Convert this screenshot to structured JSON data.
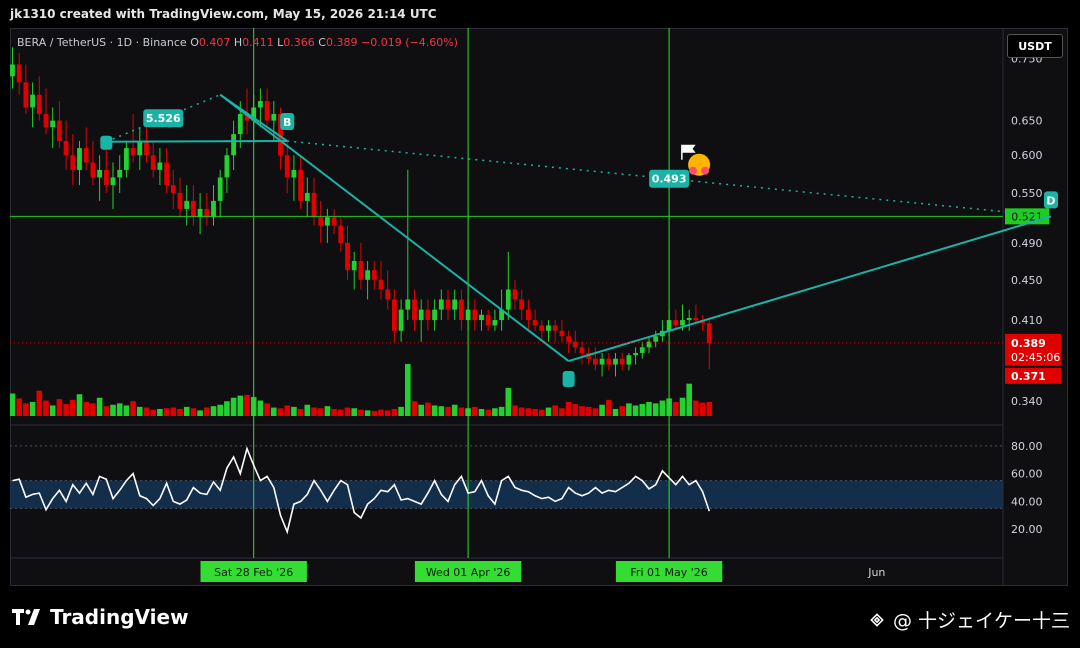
{
  "header": {
    "caption": "jk1310 created with TradingView.com, May 15, 2026 21:14 UTC"
  },
  "symbol": {
    "pair": "BERA / TetherUS · 1D · Binance",
    "o_label": "O",
    "o": "0.407",
    "h_label": "H",
    "h": "0.411",
    "l_label": "L",
    "l": "0.366",
    "c_label": "C",
    "c": "0.389",
    "change": "−0.019 (−4.60%)"
  },
  "currency_button": "USDT",
  "colors": {
    "up": "#22d030",
    "down": "#e00000",
    "pattern_line": "#1ab3a6",
    "vertical_marker": "#33dd33",
    "level_line": "#1fcc1f",
    "rsi_line": "#ffffff",
    "rsi_band": "#13365a"
  },
  "chart_data": [
    {
      "type": "candlestick",
      "scale": "log",
      "x_start": "2026-01-23",
      "ylim": [
        0.327,
        0.805
      ],
      "price_ticks": [
        "0.750",
        "0.650",
        "0.600",
        "0.550",
        "0.490",
        "0.450",
        "0.410",
        "0.340"
      ],
      "date_ticks": [
        {
          "date": "2026-02-28",
          "label": "Sat 28 Feb '26",
          "highlight": true
        },
        {
          "date": "2026-04-01",
          "label": "Wed 01 Apr '26",
          "highlight": true
        },
        {
          "date": "2026-05-01",
          "label": "Fri 01 May '26",
          "highlight": true
        },
        {
          "date": "2026-06-01",
          "label": "Jun",
          "highlight": false
        }
      ],
      "ohlc": [
        [
          0.72,
          0.77,
          0.7,
          0.74
        ],
        [
          0.74,
          0.76,
          0.69,
          0.71
        ],
        [
          0.71,
          0.74,
          0.66,
          0.67
        ],
        [
          0.67,
          0.71,
          0.64,
          0.69
        ],
        [
          0.69,
          0.72,
          0.65,
          0.66
        ],
        [
          0.66,
          0.7,
          0.63,
          0.64
        ],
        [
          0.64,
          0.67,
          0.61,
          0.65
        ],
        [
          0.65,
          0.68,
          0.61,
          0.62
        ],
        [
          0.62,
          0.65,
          0.58,
          0.6
        ],
        [
          0.6,
          0.63,
          0.56,
          0.58
        ],
        [
          0.58,
          0.62,
          0.56,
          0.61
        ],
        [
          0.61,
          0.64,
          0.58,
          0.59
        ],
        [
          0.59,
          0.62,
          0.56,
          0.57
        ],
        [
          0.57,
          0.6,
          0.54,
          0.58
        ],
        [
          0.58,
          0.61,
          0.55,
          0.56
        ],
        [
          0.56,
          0.59,
          0.53,
          0.57
        ],
        [
          0.57,
          0.6,
          0.55,
          0.58
        ],
        [
          0.58,
          0.62,
          0.57,
          0.61
        ],
        [
          0.61,
          0.66,
          0.59,
          0.6
        ],
        [
          0.6,
          0.64,
          0.58,
          0.62
        ],
        [
          0.62,
          0.64,
          0.59,
          0.6
        ],
        [
          0.6,
          0.62,
          0.57,
          0.58
        ],
        [
          0.58,
          0.61,
          0.56,
          0.59
        ],
        [
          0.59,
          0.61,
          0.55,
          0.56
        ],
        [
          0.56,
          0.58,
          0.53,
          0.55
        ],
        [
          0.55,
          0.57,
          0.52,
          0.53
        ],
        [
          0.53,
          0.56,
          0.51,
          0.54
        ],
        [
          0.54,
          0.56,
          0.51,
          0.52
        ],
        [
          0.52,
          0.55,
          0.5,
          0.53
        ],
        [
          0.53,
          0.55,
          0.51,
          0.52
        ],
        [
          0.52,
          0.56,
          0.51,
          0.54
        ],
        [
          0.54,
          0.58,
          0.52,
          0.57
        ],
        [
          0.57,
          0.61,
          0.55,
          0.6
        ],
        [
          0.6,
          0.65,
          0.58,
          0.63
        ],
        [
          0.63,
          0.68,
          0.61,
          0.66
        ],
        [
          0.66,
          0.7,
          0.63,
          0.65
        ],
        [
          0.65,
          0.69,
          0.62,
          0.67
        ],
        [
          0.67,
          0.7,
          0.64,
          0.68
        ],
        [
          0.68,
          0.7,
          0.64,
          0.65
        ],
        [
          0.65,
          0.68,
          0.62,
          0.66
        ],
        [
          0.66,
          0.67,
          0.58,
          0.6
        ],
        [
          0.6,
          0.62,
          0.55,
          0.57
        ],
        [
          0.57,
          0.6,
          0.54,
          0.58
        ],
        [
          0.58,
          0.6,
          0.53,
          0.54
        ],
        [
          0.54,
          0.57,
          0.52,
          0.55
        ],
        [
          0.55,
          0.57,
          0.51,
          0.52
        ],
        [
          0.52,
          0.54,
          0.49,
          0.51
        ],
        [
          0.51,
          0.53,
          0.49,
          0.52
        ],
        [
          0.52,
          0.53,
          0.5,
          0.51
        ],
        [
          0.51,
          0.52,
          0.48,
          0.49
        ],
        [
          0.49,
          0.51,
          0.45,
          0.46
        ],
        [
          0.46,
          0.48,
          0.44,
          0.47
        ],
        [
          0.47,
          0.49,
          0.44,
          0.45
        ],
        [
          0.45,
          0.47,
          0.43,
          0.46
        ],
        [
          0.46,
          0.47,
          0.44,
          0.45
        ],
        [
          0.45,
          0.47,
          0.43,
          0.44
        ],
        [
          0.44,
          0.46,
          0.42,
          0.43
        ],
        [
          0.43,
          0.44,
          0.39,
          0.4
        ],
        [
          0.4,
          0.43,
          0.39,
          0.42
        ],
        [
          0.42,
          0.58,
          0.41,
          0.43
        ],
        [
          0.43,
          0.44,
          0.4,
          0.41
        ],
        [
          0.41,
          0.43,
          0.39,
          0.42
        ],
        [
          0.42,
          0.43,
          0.4,
          0.41
        ],
        [
          0.41,
          0.43,
          0.4,
          0.42
        ],
        [
          0.42,
          0.44,
          0.41,
          0.43
        ],
        [
          0.43,
          0.44,
          0.41,
          0.42
        ],
        [
          0.42,
          0.44,
          0.41,
          0.43
        ],
        [
          0.43,
          0.44,
          0.4,
          0.41
        ],
        [
          0.41,
          0.43,
          0.4,
          0.42
        ],
        [
          0.42,
          0.43,
          0.4,
          0.41
        ],
        [
          0.41,
          0.42,
          0.4,
          0.415
        ],
        [
          0.415,
          0.42,
          0.4,
          0.405
        ],
        [
          0.405,
          0.42,
          0.4,
          0.41
        ],
        [
          0.41,
          0.44,
          0.4,
          0.42
        ],
        [
          0.42,
          0.48,
          0.41,
          0.44
        ],
        [
          0.44,
          0.45,
          0.42,
          0.43
        ],
        [
          0.43,
          0.44,
          0.41,
          0.42
        ],
        [
          0.42,
          0.43,
          0.4,
          0.41
        ],
        [
          0.41,
          0.42,
          0.4,
          0.405
        ],
        [
          0.405,
          0.41,
          0.39,
          0.4
        ],
        [
          0.4,
          0.41,
          0.39,
          0.405
        ],
        [
          0.405,
          0.41,
          0.39,
          0.4
        ],
        [
          0.4,
          0.41,
          0.39,
          0.395
        ],
        [
          0.395,
          0.4,
          0.38,
          0.39
        ],
        [
          0.39,
          0.4,
          0.38,
          0.385
        ],
        [
          0.385,
          0.39,
          0.37,
          0.38
        ],
        [
          0.38,
          0.385,
          0.37,
          0.375
        ],
        [
          0.375,
          0.385,
          0.365,
          0.37
        ],
        [
          0.37,
          0.38,
          0.36,
          0.375
        ],
        [
          0.375,
          0.38,
          0.365,
          0.37
        ],
        [
          0.37,
          0.38,
          0.36,
          0.375
        ],
        [
          0.375,
          0.38,
          0.365,
          0.37
        ],
        [
          0.37,
          0.38,
          0.365,
          0.378
        ],
        [
          0.378,
          0.385,
          0.37,
          0.38
        ],
        [
          0.38,
          0.39,
          0.375,
          0.385
        ],
        [
          0.385,
          0.395,
          0.38,
          0.39
        ],
        [
          0.39,
          0.4,
          0.385,
          0.395
        ],
        [
          0.395,
          0.41,
          0.39,
          0.4
        ],
        [
          0.4,
          0.42,
          0.395,
          0.41
        ],
        [
          0.41,
          0.42,
          0.4,
          0.405
        ],
        [
          0.405,
          0.425,
          0.4,
          0.41
        ],
        [
          0.41,
          0.42,
          0.4,
          0.412
        ],
        [
          0.412,
          0.425,
          0.405,
          0.41
        ],
        [
          0.41,
          0.415,
          0.4,
          0.407
        ],
        [
          0.407,
          0.411,
          0.366,
          0.389
        ]
      ],
      "volume": [
        3.2,
        2.5,
        1.8,
        2.0,
        3.6,
        2.2,
        1.5,
        2.4,
        1.7,
        2.3,
        3.1,
        2.0,
        1.8,
        2.6,
        1.4,
        1.6,
        1.8,
        1.5,
        2.1,
        1.3,
        1.2,
        0.9,
        1.0,
        1.1,
        1.2,
        1.0,
        1.3,
        1.1,
        0.8,
        1.2,
        1.4,
        1.6,
        2.1,
        2.6,
        2.9,
        3.0,
        2.7,
        2.2,
        1.8,
        1.2,
        1.1,
        1.5,
        1.3,
        1.0,
        1.6,
        1.2,
        1.1,
        1.4,
        1.0,
        0.9,
        1.2,
        1.1,
        0.9,
        0.8,
        0.7,
        0.9,
        0.8,
        1.0,
        1.3,
        7.4,
        2.1,
        1.6,
        1.9,
        1.5,
        1.4,
        1.3,
        1.6,
        1.2,
        1.1,
        1.3,
        1.0,
        0.9,
        1.1,
        1.3,
        4.0,
        1.5,
        1.2,
        1.1,
        1.0,
        0.9,
        1.2,
        1.5,
        1.1,
        2.0,
        1.7,
        1.4,
        1.3,
        1.1,
        1.6,
        2.3,
        1.0,
        1.4,
        1.8,
        1.5,
        1.7,
        2.0,
        1.8,
        2.2,
        2.5,
        2.0,
        2.6,
        4.6,
        2.2,
        1.9,
        2.0
      ],
      "rsi": {
        "ticks": [
          "80.00",
          "60.00",
          "40.00",
          "20.00"
        ],
        "band": [
          35,
          55
        ],
        "values": [
          55,
          56,
          43,
          45,
          46,
          34,
          42,
          48,
          40,
          52,
          46,
          53,
          45,
          58,
          56,
          42,
          48,
          55,
          60,
          44,
          42,
          37,
          42,
          53,
          40,
          38,
          41,
          50,
          46,
          45,
          54,
          48,
          64,
          72,
          60,
          78,
          66,
          55,
          58,
          50,
          30,
          18,
          38,
          40,
          45,
          55,
          48,
          40,
          48,
          55,
          52,
          32,
          28,
          38,
          42,
          48,
          47,
          52,
          41,
          42,
          40,
          38,
          46,
          55,
          45,
          40,
          52,
          58,
          46,
          47,
          55,
          44,
          38,
          55,
          58,
          50,
          48,
          47,
          44,
          42,
          43,
          40,
          42,
          50,
          46,
          44,
          46,
          50,
          46,
          48,
          47,
          50,
          53,
          58,
          55,
          49,
          52,
          62,
          57,
          52,
          58,
          52,
          55,
          47,
          33
        ]
      },
      "pattern_labels": [
        "B",
        "D"
      ],
      "pattern_xabcd_prices": [
        0.619,
        0.69,
        0.373,
        0.521
      ],
      "pattern_x_indices": [
        14,
        31,
        83,
        155
      ],
      "pattern_b_date": "2026-03-05",
      "ratio_labels": [
        "5.526",
        "0.493"
      ],
      "level_line": "0.521",
      "price_tags": {
        "close": "0.389",
        "countdown": "02:45:06",
        "low": "0.371"
      }
    }
  ],
  "footer": {
    "logo": "TradingView",
    "author": "@ 十ジェイケー十三"
  }
}
